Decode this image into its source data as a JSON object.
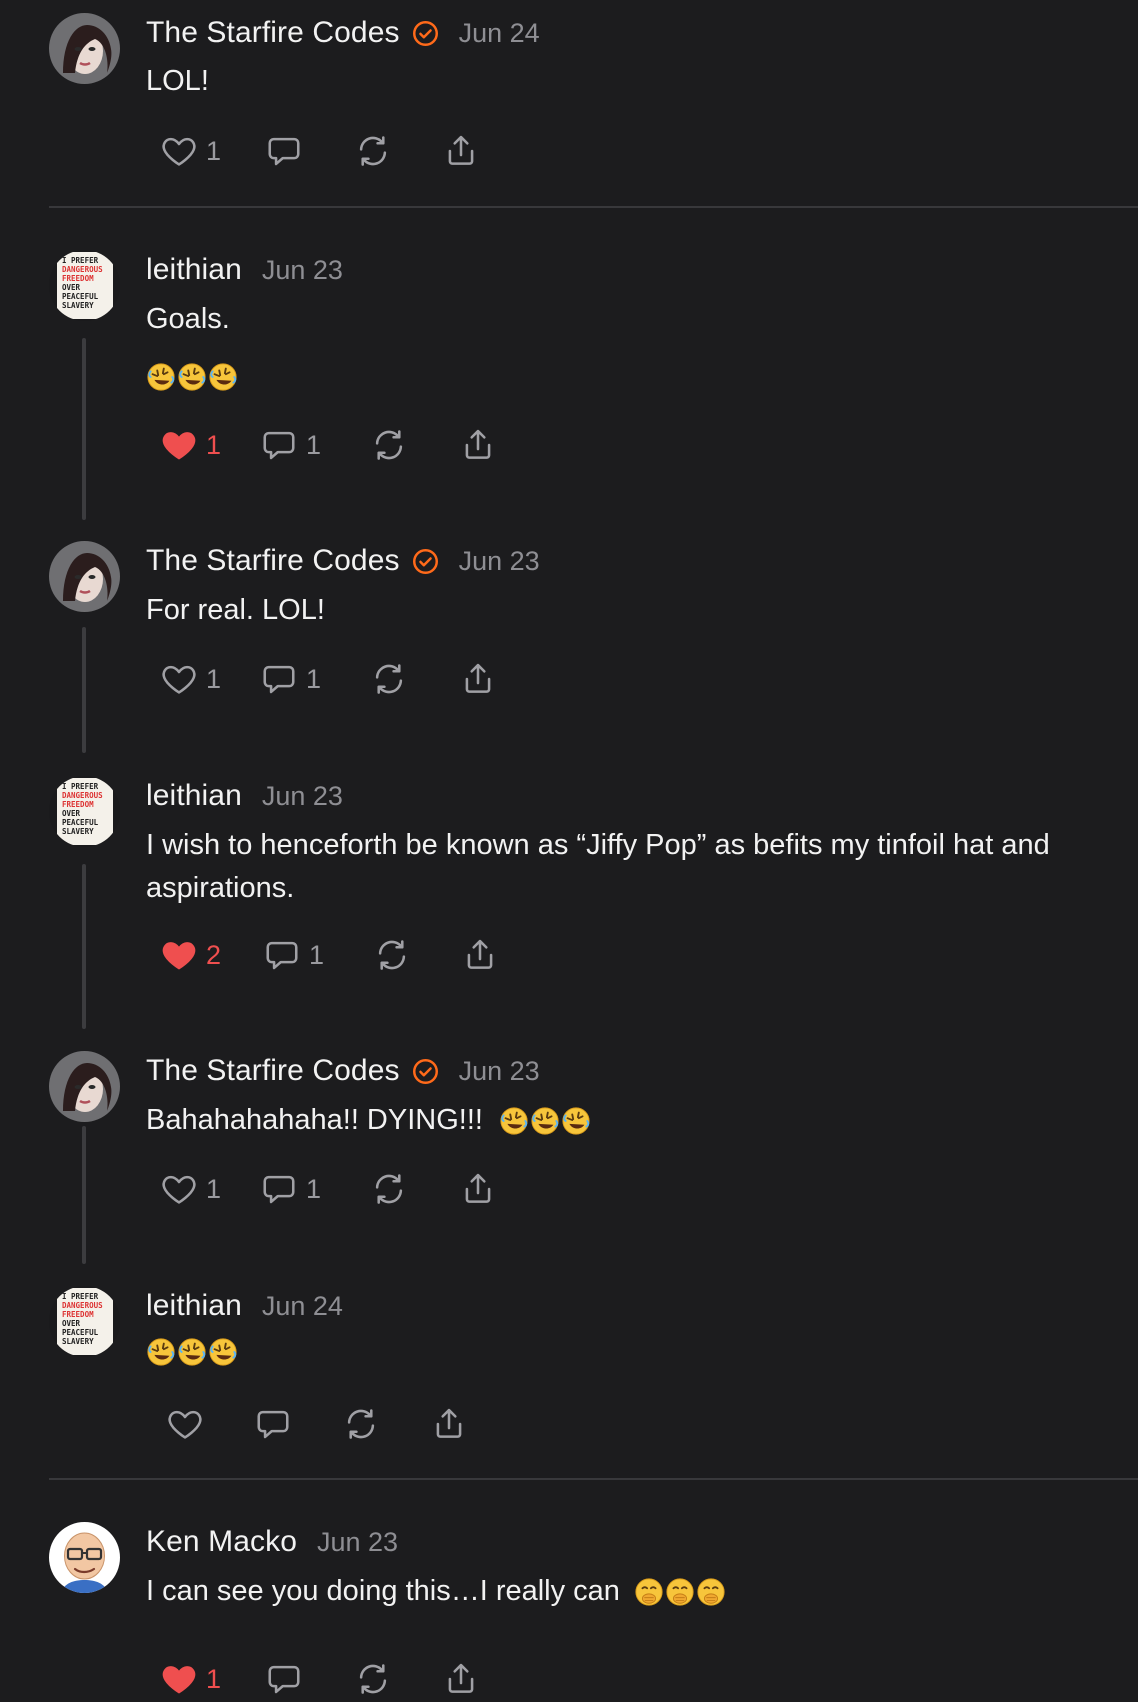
{
  "colors": {
    "background": "#1c1c1e",
    "verified_badge": "#ff6a1a",
    "like_active": "#ef4f4f",
    "icon": "#9a9a9f"
  },
  "posts": [
    {
      "author": "The Starfire Codes",
      "verified": true,
      "date": "Jun 24",
      "text": "LOL!",
      "emoji": [],
      "like_count": "1",
      "liked": false,
      "reply_count": ""
    },
    {
      "author": "leithian",
      "verified": false,
      "date": "Jun 23",
      "text": "Goals.",
      "emoji": [
        "rolling-on-floor-laughing",
        "rolling-on-floor-laughing",
        "rolling-on-floor-laughing"
      ],
      "like_count": "1",
      "liked": true,
      "reply_count": "1"
    },
    {
      "author": "The Starfire Codes",
      "verified": true,
      "date": "Jun 23",
      "text": "For real. LOL!",
      "emoji": [],
      "like_count": "1",
      "liked": false,
      "reply_count": "1"
    },
    {
      "author": "leithian",
      "verified": false,
      "date": "Jun 23",
      "text": "I wish to henceforth be known as “Jiffy Pop” as befits my tinfoil hat and aspirations.",
      "emoji": [],
      "like_count": "2",
      "liked": true,
      "reply_count": "1"
    },
    {
      "author": "The Starfire Codes",
      "verified": true,
      "date": "Jun 23",
      "text": "Bahahahahaha!! DYING!!!",
      "emoji": [
        "rolling-on-floor-laughing",
        "rolling-on-floor-laughing",
        "rolling-on-floor-laughing"
      ],
      "like_count": "1",
      "liked": false,
      "reply_count": "1"
    },
    {
      "author": "leithian",
      "verified": false,
      "date": "Jun 24",
      "text": "",
      "emoji": [
        "rolling-on-floor-laughing",
        "rolling-on-floor-laughing",
        "rolling-on-floor-laughing"
      ],
      "like_count": "",
      "liked": false,
      "reply_count": ""
    },
    {
      "author": "Ken Macko",
      "verified": false,
      "date": "Jun 23",
      "text": "I can see you doing this…I really can",
      "emoji": [
        "face-with-hand-over-mouth",
        "face-with-hand-over-mouth",
        "face-with-hand-over-mouth"
      ],
      "like_count": "1",
      "liked": true,
      "reply_count": ""
    }
  ],
  "avatars": {
    "leithian_book_text": [
      "I PREFER",
      "DANGEROUS",
      "FREEDOM",
      "OVER",
      "PEACEFUL",
      "SLAVERY"
    ]
  }
}
